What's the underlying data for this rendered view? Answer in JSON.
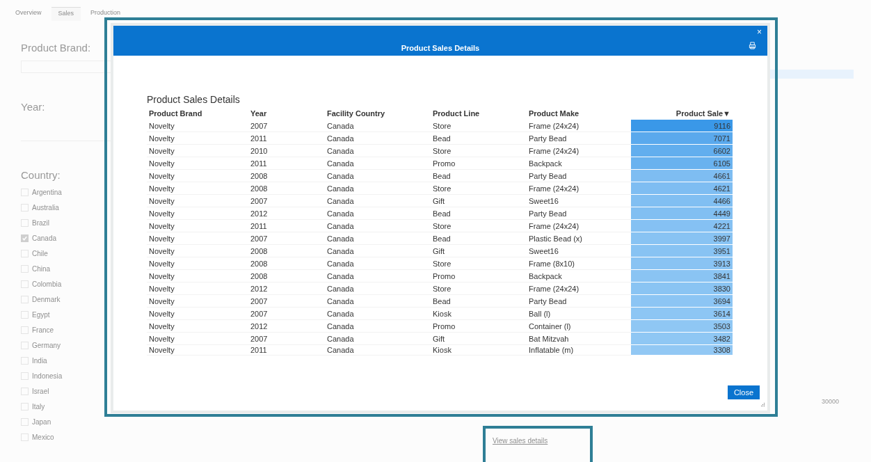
{
  "tabs": [
    {
      "label": "Overview",
      "selected": false
    },
    {
      "label": "Sales",
      "selected": true
    },
    {
      "label": "Production",
      "selected": false
    }
  ],
  "filters": {
    "brand_label": "Product Brand:",
    "year_label": "Year:",
    "country_label": "Country:",
    "countries": [
      {
        "label": "Argentina",
        "checked": false
      },
      {
        "label": "Australia",
        "checked": false
      },
      {
        "label": "Brazil",
        "checked": false
      },
      {
        "label": "Canada",
        "checked": true
      },
      {
        "label": "Chile",
        "checked": false
      },
      {
        "label": "China",
        "checked": false
      },
      {
        "label": "Colombia",
        "checked": false
      },
      {
        "label": "Denmark",
        "checked": false
      },
      {
        "label": "Egypt",
        "checked": false
      },
      {
        "label": "France",
        "checked": false
      },
      {
        "label": "Germany",
        "checked": false
      },
      {
        "label": "India",
        "checked": false
      },
      {
        "label": "Indonesia",
        "checked": false
      },
      {
        "label": "Israel",
        "checked": false
      },
      {
        "label": "Italy",
        "checked": false
      },
      {
        "label": "Japan",
        "checked": false
      },
      {
        "label": "Mexico",
        "checked": false
      }
    ]
  },
  "chart_tick": "30000",
  "link": "View sales details",
  "dialog": {
    "title": "Product Sales Details",
    "close_glyph": "×",
    "heading": "Product Sales Details",
    "columns": [
      "Product Brand",
      "Year",
      "Facility Country",
      "Product Line",
      "Product Make",
      "Product Sale"
    ],
    "sort_indicator": "▼",
    "rows": [
      {
        "cells": [
          "Novelty",
          "2007",
          "Canada",
          "Store",
          "Frame (24x24)",
          "9116"
        ],
        "color": "#3a98e8"
      },
      {
        "cells": [
          "Novelty",
          "2011",
          "Canada",
          "Bead",
          "Party Bead",
          "7071"
        ],
        "color": "#5aa9ed"
      },
      {
        "cells": [
          "Novelty",
          "2010",
          "Canada",
          "Store",
          "Frame (24x24)",
          "6602"
        ],
        "color": "#62aeee"
      },
      {
        "cells": [
          "Novelty",
          "2011",
          "Canada",
          "Promo",
          "Backpack",
          "6105"
        ],
        "color": "#69b2ef"
      },
      {
        "cells": [
          "Novelty",
          "2008",
          "Canada",
          "Bead",
          "Party Bead",
          "4661"
        ],
        "color": "#7ebdf2"
      },
      {
        "cells": [
          "Novelty",
          "2008",
          "Canada",
          "Store",
          "Frame (24x24)",
          "4621"
        ],
        "color": "#7ebdf2"
      },
      {
        "cells": [
          "Novelty",
          "2007",
          "Canada",
          "Gift",
          "Sweet16",
          "4466"
        ],
        "color": "#81bff2"
      },
      {
        "cells": [
          "Novelty",
          "2012",
          "Canada",
          "Bead",
          "Party Bead",
          "4449"
        ],
        "color": "#81bff2"
      },
      {
        "cells": [
          "Novelty",
          "2011",
          "Canada",
          "Store",
          "Frame (24x24)",
          "4221"
        ],
        "color": "#85c1f3"
      },
      {
        "cells": [
          "Novelty",
          "2007",
          "Canada",
          "Bead",
          "Plastic Bead (x)",
          "3997"
        ],
        "color": "#88c3f3"
      },
      {
        "cells": [
          "Novelty",
          "2008",
          "Canada",
          "Gift",
          "Sweet16",
          "3951"
        ],
        "color": "#88c3f3"
      },
      {
        "cells": [
          "Novelty",
          "2008",
          "Canada",
          "Store",
          "Frame (8x10)",
          "3913"
        ],
        "color": "#89c3f3"
      },
      {
        "cells": [
          "Novelty",
          "2008",
          "Canada",
          "Promo",
          "Backpack",
          "3841"
        ],
        "color": "#8ac4f3"
      },
      {
        "cells": [
          "Novelty",
          "2012",
          "Canada",
          "Store",
          "Frame (24x24)",
          "3830"
        ],
        "color": "#8ac4f3"
      },
      {
        "cells": [
          "Novelty",
          "2007",
          "Canada",
          "Bead",
          "Party Bead",
          "3694"
        ],
        "color": "#8cc5f4"
      },
      {
        "cells": [
          "Novelty",
          "2007",
          "Canada",
          "Kiosk",
          "Ball (l)",
          "3614"
        ],
        "color": "#8dc6f4"
      },
      {
        "cells": [
          "Novelty",
          "2012",
          "Canada",
          "Promo",
          "Container (l)",
          "3503"
        ],
        "color": "#8fc7f4"
      },
      {
        "cells": [
          "Novelty",
          "2007",
          "Canada",
          "Gift",
          "Bat Mitzvah",
          "3482"
        ],
        "color": "#8fc7f4"
      },
      {
        "cells": [
          "Novelty",
          "2011",
          "Canada",
          "Kiosk",
          "Inflatable (m)",
          "3308"
        ],
        "color": "#92c8f4"
      }
    ],
    "close_button": "Close"
  }
}
